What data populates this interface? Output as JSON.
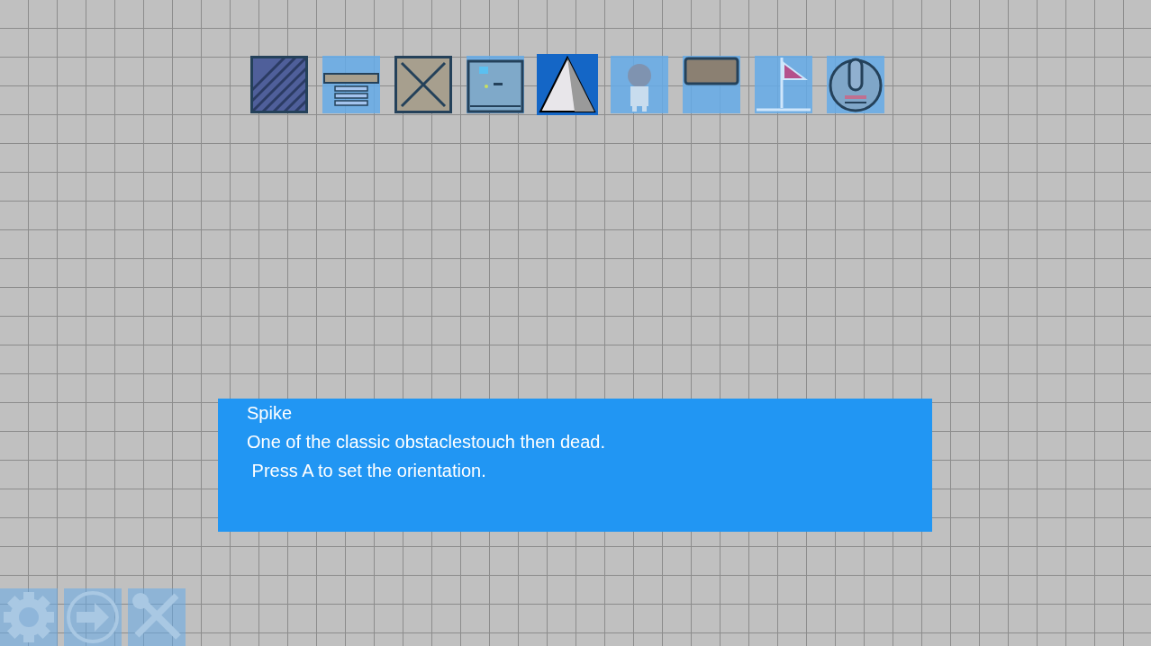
{
  "palette": [
    {
      "kind": "block",
      "selected": false
    },
    {
      "kind": "spring",
      "selected": false
    },
    {
      "kind": "crate",
      "selected": false
    },
    {
      "kind": "machine",
      "selected": false
    },
    {
      "kind": "spike",
      "selected": true
    },
    {
      "kind": "character",
      "selected": false
    },
    {
      "kind": "platform",
      "selected": false
    },
    {
      "kind": "flag",
      "selected": false
    },
    {
      "kind": "robot",
      "selected": false
    }
  ],
  "info_panel": {
    "title": "Spike",
    "lines": [
      "One of the classic obstaclestouch then dead.",
      " Press A to set the orientation."
    ]
  },
  "toolbar": [
    {
      "kind": "settings"
    },
    {
      "kind": "next"
    },
    {
      "kind": "tools"
    }
  ]
}
